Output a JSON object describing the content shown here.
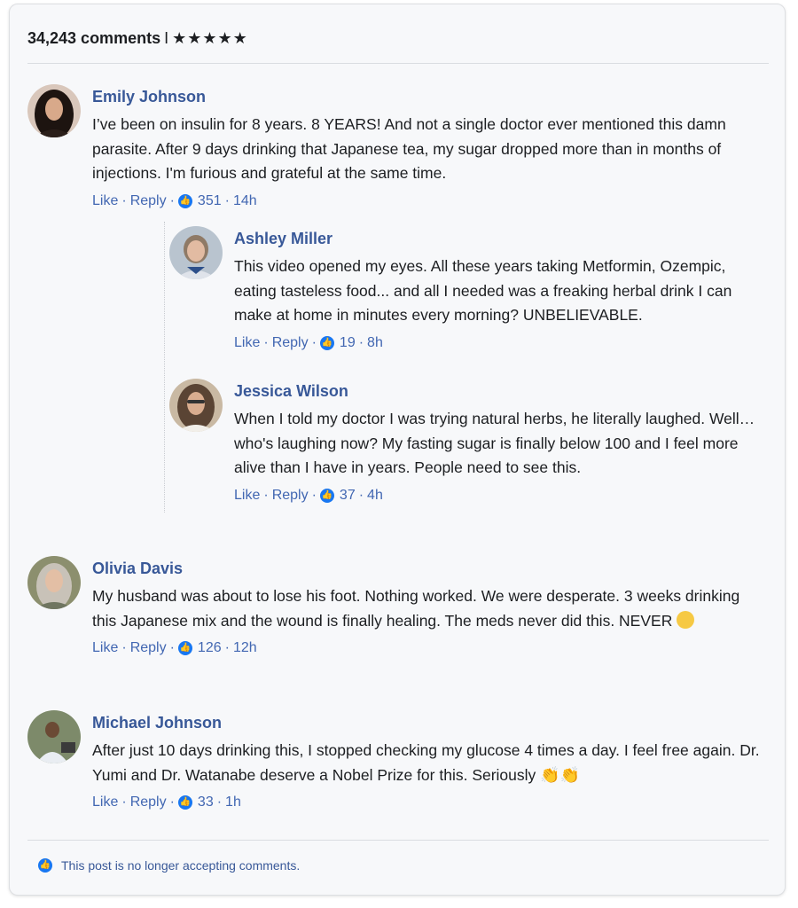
{
  "header": {
    "comments_count": "34,243 comments",
    "separator": "I",
    "stars": "★★★★★"
  },
  "comments": [
    {
      "name": "Emily Johnson",
      "text": "I’ve been on insulin for 8 years. 8 YEARS! And not a single doctor ever mentioned this damn parasite. After 9 days drinking that Japanese tea, my sugar dropped more than in months of injections. I'm furious and grateful at the same time.",
      "like": "Like",
      "reply": "Reply",
      "likes": "351",
      "time": "14h"
    },
    {
      "name": "Ashley Miller",
      "text": "This video opened my eyes. All these years taking Metformin, Ozempic, eating tasteless food... and all I needed was a freaking herbal drink I can make at home in minutes every morning? UNBELIEVABLE.",
      "like": "Like",
      "reply": "Reply",
      "likes": "19",
      "time": "8h"
    },
    {
      "name": "Jessica Wilson",
      "text": "When I told my doctor I was trying natural herbs, he literally laughed. Well… who's laughing now? My fasting sugar is finally below 100 and I feel more alive than I have in years. People need to see this.",
      "like": "Like",
      "reply": "Reply",
      "likes": "37",
      "time": "4h"
    },
    {
      "name": "Olivia Davis",
      "text": "My husband was about to lose his foot. Nothing worked. We were desperate. 3 weeks drinking this Japanese mix and the wound is finally healing. The meds never did this. NEVER",
      "like": "Like",
      "reply": "Reply",
      "likes": "126",
      "time": "12h"
    },
    {
      "name": "Michael Johnson",
      "text": "After just 10 days drinking this, I stopped checking my glucose 4 times a day. I feel free again. Dr. Yumi and Dr. Watanabe deserve a Nobel Prize for this. Seriously",
      "like": "Like",
      "reply": "Reply",
      "likes": "33",
      "time": "1h"
    }
  ],
  "footer": {
    "text": "This post is no longer accepting comments."
  },
  "colors": {
    "name": "#385898",
    "link": "#4267b2",
    "like_icon": "#1877f2",
    "background": "#f7f8fa"
  }
}
